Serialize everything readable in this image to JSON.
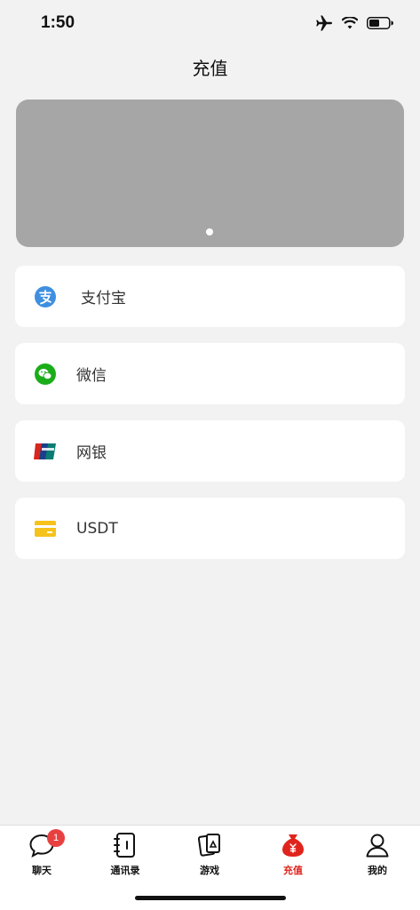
{
  "status": {
    "time": "1:50"
  },
  "nav": {
    "title": "充值"
  },
  "payments": [
    {
      "label": "支付宝",
      "icon": "alipay-icon"
    },
    {
      "label": "微信",
      "icon": "wechat-icon"
    },
    {
      "label": "网银",
      "icon": "unionpay-icon"
    },
    {
      "label": "USDT",
      "icon": "card-icon"
    }
  ],
  "tabs": [
    {
      "label": "聊天",
      "icon": "chat-icon",
      "badge": "1"
    },
    {
      "label": "通讯录",
      "icon": "contacts-icon"
    },
    {
      "label": "游戏",
      "icon": "game-icon"
    },
    {
      "label": "充值",
      "icon": "money-bag-icon",
      "active": true
    },
    {
      "label": "我的",
      "icon": "profile-icon"
    }
  ],
  "colors": {
    "accent": "#e0241d",
    "banner": "#a6a6a6",
    "background": "#f2f2f2"
  }
}
